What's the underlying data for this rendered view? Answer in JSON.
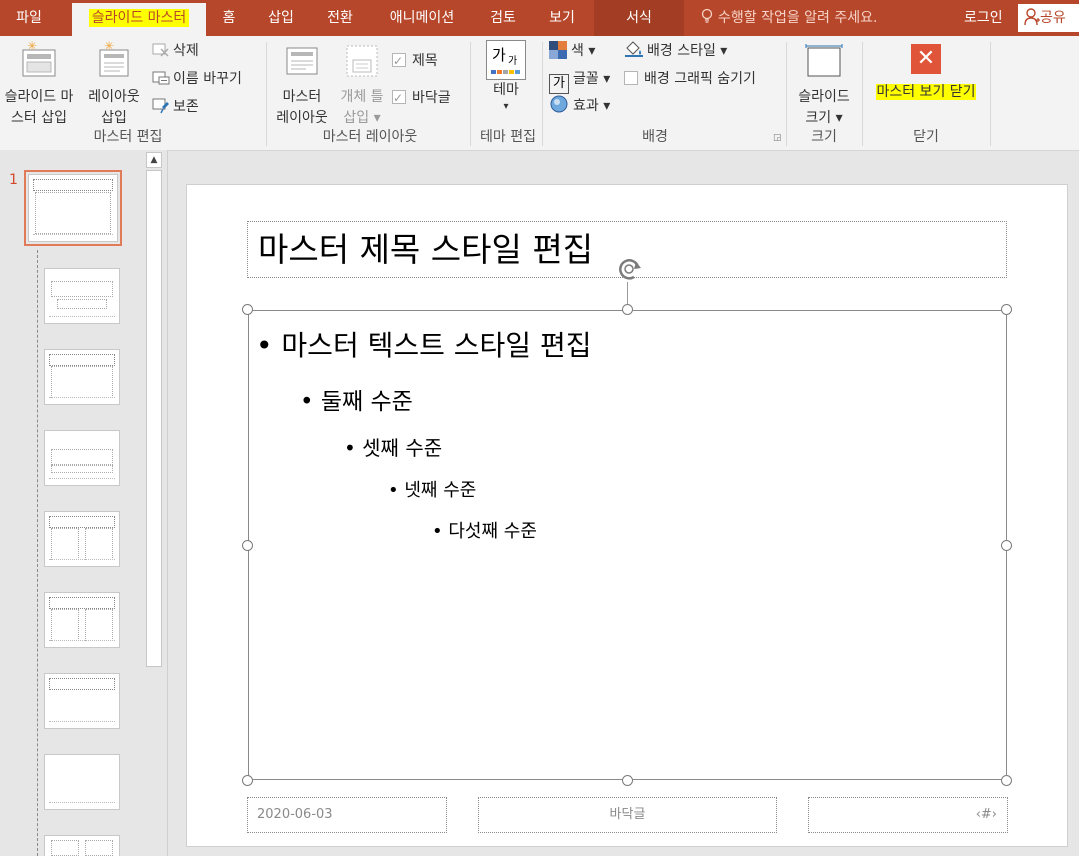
{
  "tabs": [
    {
      "label": "파일"
    },
    {
      "label": "슬라이드 마스터"
    },
    {
      "label": "홈"
    },
    {
      "label": "삽입"
    },
    {
      "label": "전환"
    },
    {
      "label": "애니메이션"
    },
    {
      "label": "검토"
    },
    {
      "label": "보기"
    },
    {
      "label": "서식"
    }
  ],
  "tell_me": "수행할 작업을 알려 주세요.",
  "login": "로그인",
  "share": "공유",
  "ribbon": {
    "master_edit": {
      "insert_master_l1": "슬라이드 마",
      "insert_master_l2": "스터 삽입",
      "insert_layout_l1": "레이아웃",
      "insert_layout_l2": "삽입",
      "delete": "삭제",
      "rename": "이름 바꾸기",
      "preserve": "보존",
      "group": "마스터 편집"
    },
    "master_layout": {
      "master_layout_l1": "마스터",
      "master_layout_l2": "레이아웃",
      "insert_placeholder_l1": "개체 틀",
      "insert_placeholder_l2": "삽입",
      "title_chk": "제목",
      "footer_chk": "바닥글",
      "group": "마스터 레이아웃"
    },
    "edit_theme": {
      "theme_glyph": "가",
      "theme_glyph_small": "가",
      "theme": "테마",
      "group": "테마 편집"
    },
    "background": {
      "colors": "색",
      "fonts": "글꼴",
      "fonts_glyph": "가",
      "effects": "효과",
      "bg_styles": "배경 스타일",
      "hide_bg": "배경 그래픽 숨기기",
      "group": "배경"
    },
    "size": {
      "slide_size_l1": "슬라이드",
      "slide_size_l2": "크기",
      "group": "크기"
    },
    "close": {
      "close_master": "마스터 보기 닫기",
      "group": "닫기"
    }
  },
  "thumbnails": {
    "selected_number": "1"
  },
  "slide": {
    "title": "마스터 제목 스타일 편집",
    "levels": [
      "마스터 텍스트 스타일 편집",
      "둘째 수준",
      "셋째 수준",
      "넷째 수준",
      "다섯째 수준"
    ],
    "footer_date": "2020-06-03",
    "footer_text": "바닥글",
    "footer_num": "‹#›"
  },
  "colors": {
    "accent": "#b7472a",
    "highlight": "#ffff00",
    "close_red": "#e0553a"
  }
}
